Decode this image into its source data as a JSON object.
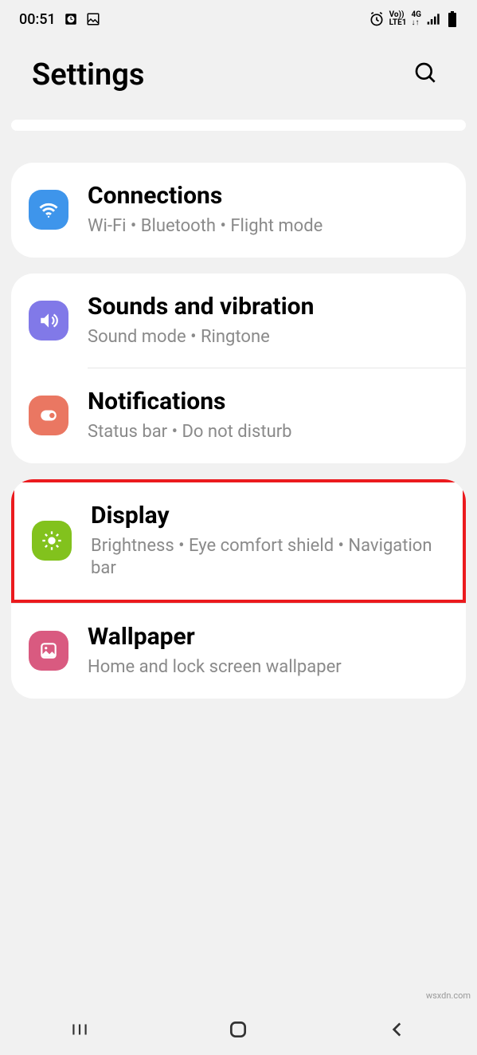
{
  "status": {
    "time": "00:51"
  },
  "header": {
    "title": "Settings"
  },
  "groups": [
    {
      "items": [
        {
          "id": "connections",
          "title": "Connections",
          "subtitle": "Wi-Fi  •  Bluetooth  •  Flight mode",
          "color": "blue",
          "highlighted": false
        }
      ]
    },
    {
      "items": [
        {
          "id": "sounds",
          "title": "Sounds and vibration",
          "subtitle": "Sound mode  •  Ringtone",
          "color": "purple",
          "highlighted": false
        },
        {
          "id": "notifications",
          "title": "Notifications",
          "subtitle": "Status bar  •  Do not disturb",
          "color": "coral",
          "highlighted": false
        }
      ]
    },
    {
      "items": [
        {
          "id": "display",
          "title": "Display",
          "subtitle": "Brightness  •  Eye comfort shield  •  Navigation bar",
          "color": "green",
          "highlighted": true
        },
        {
          "id": "wallpaper",
          "title": "Wallpaper",
          "subtitle": "Home and lock screen wallpaper",
          "color": "pink",
          "highlighted": false
        }
      ]
    }
  ],
  "watermark": "wsxdn.com"
}
